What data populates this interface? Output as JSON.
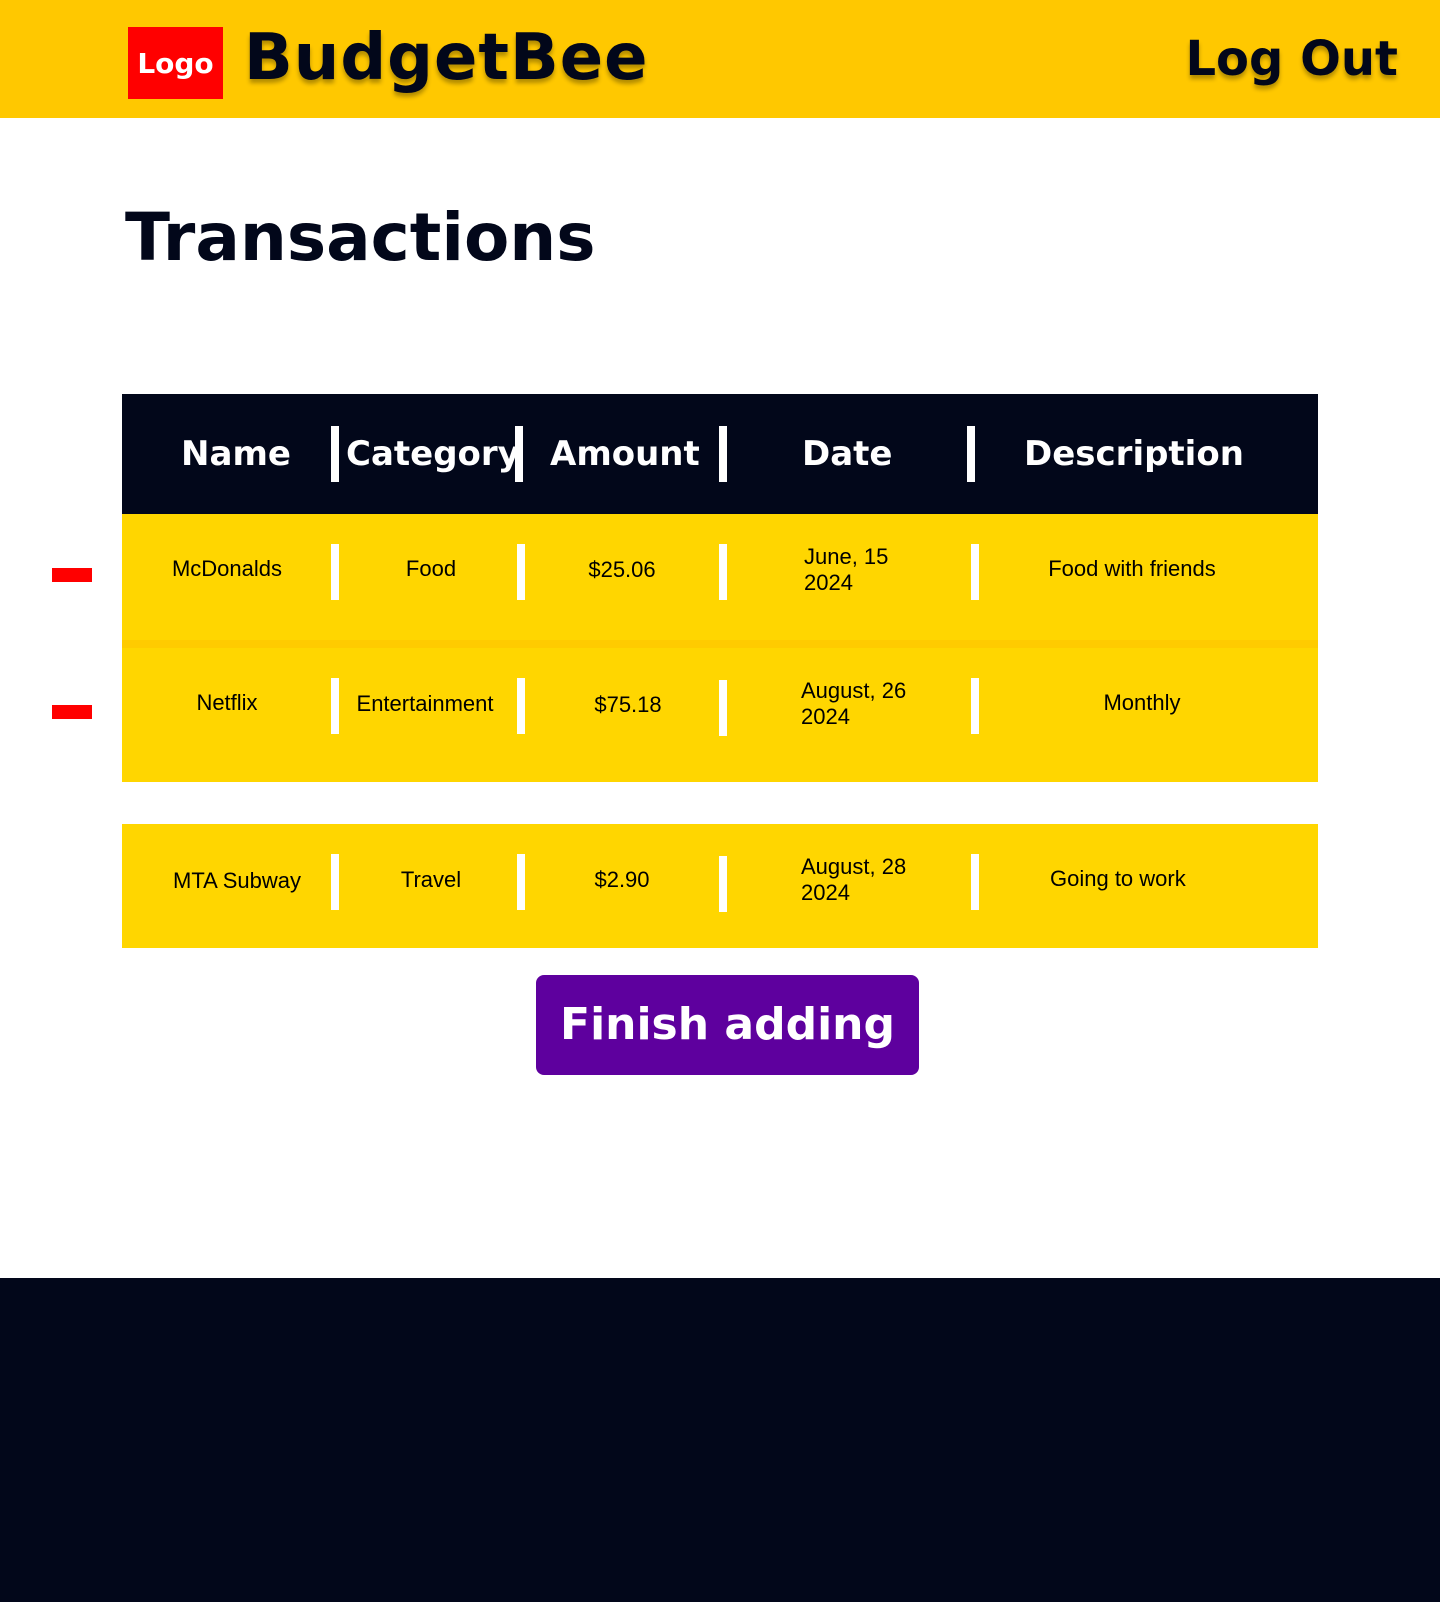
{
  "header": {
    "logo_text": "Logo",
    "brand": "BudgetBee",
    "logout_label": "Log Out"
  },
  "page": {
    "title": "Transactions"
  },
  "table": {
    "columns": [
      "Name",
      "Category",
      "Amount",
      "Date",
      "Description"
    ],
    "rows": [
      {
        "name": "McDonalds",
        "category": "Food",
        "amount": "$25.06",
        "date_line1": "June, 15",
        "date_line2": "2024",
        "description": "Food with friends"
      },
      {
        "name": "Netflix",
        "category": "Entertainment",
        "amount": "$75.18",
        "date_line1": "August, 26",
        "date_line2": "2024",
        "description": "Monthly"
      },
      {
        "name": "MTA Subway",
        "category": "Travel",
        "amount": "$2.90",
        "date_line1": "August, 28",
        "date_line2": "2024",
        "description": "Going to work"
      }
    ]
  },
  "actions": {
    "finish_label": "Finish adding"
  },
  "icons": {
    "remove_row": "minus-icon"
  },
  "colors": {
    "header_bg": "#FFC800",
    "row_bg": "#FFD600",
    "dark": "#02071A",
    "logo_bg": "#FF0000",
    "button_bg": "#5E009E"
  }
}
